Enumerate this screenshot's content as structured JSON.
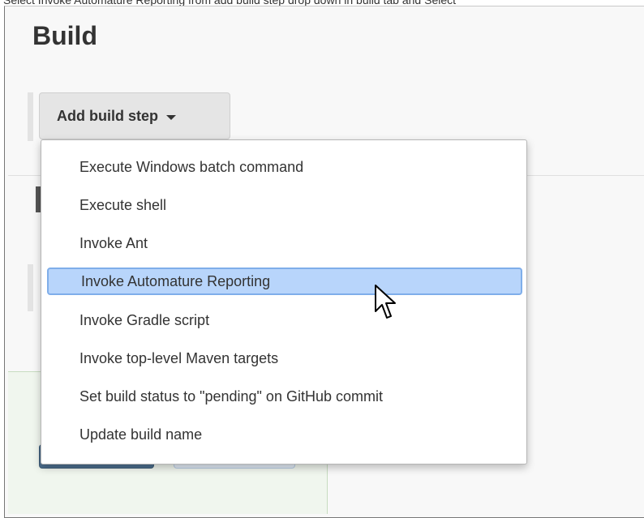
{
  "caption": "Select Invoke Automature Reporting from add build step drop down in build tab and Select",
  "section": {
    "title": "Build"
  },
  "add_step_button": {
    "label": "Add build step"
  },
  "menu": {
    "items": [
      {
        "label": "Execute Windows batch command"
      },
      {
        "label": "Execute shell"
      },
      {
        "label": "Invoke Ant"
      },
      {
        "label": "Invoke Automature Reporting",
        "highlighted": true
      },
      {
        "label": "Invoke Gradle script"
      },
      {
        "label": "Invoke top-level Maven targets"
      },
      {
        "label": "Set build status to \"pending\" on GitHub commit"
      },
      {
        "label": "Update build name"
      }
    ]
  },
  "colors": {
    "highlight_bg": "#b8d5fb",
    "highlight_border": "#7faeea",
    "button_bg": "#e5e5e5",
    "panel_green": "#f0f6ee"
  },
  "icons": {
    "caret": "caret-down-icon",
    "cursor": "mouse-pointer-icon"
  }
}
